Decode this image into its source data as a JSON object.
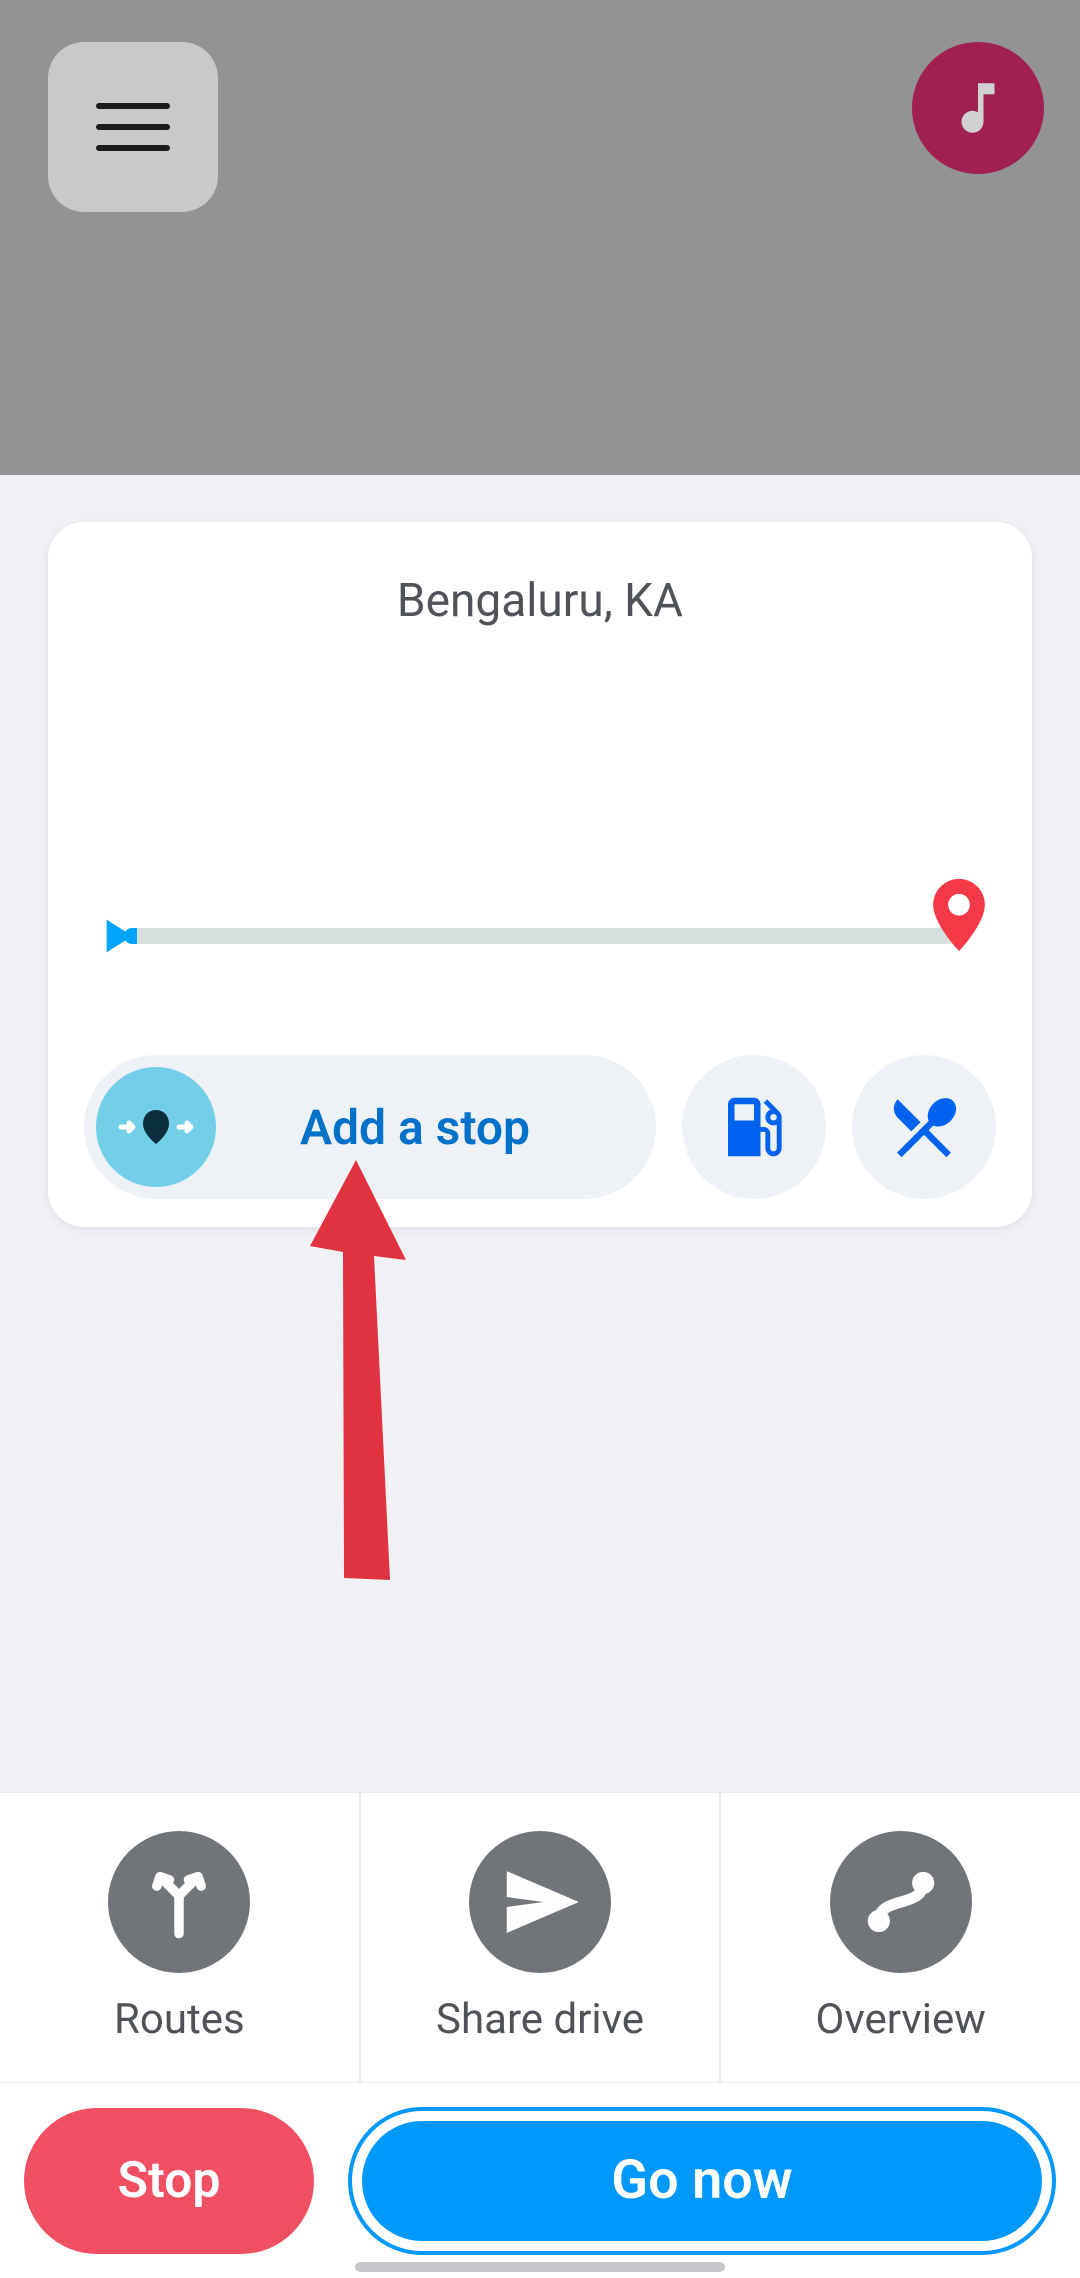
{
  "header": {
    "menu_icon": "hamburger-icon",
    "music_icon": "music-icon"
  },
  "destination": {
    "title": "Bengaluru, KA"
  },
  "chips": {
    "add_stop_label": "Add a stop",
    "gas_icon": "gas-pump-icon",
    "food_icon": "restaurant-icon"
  },
  "actions": {
    "routes_label": "Routes",
    "share_label": "Share drive",
    "overview_label": "Overview"
  },
  "bottom": {
    "stop_label": "Stop",
    "go_label": "Go now"
  },
  "colors": {
    "accent_blue": "#0098fb",
    "accent_red": "#f15062",
    "link_blue": "#0063ef",
    "music_bg": "#a12052"
  }
}
